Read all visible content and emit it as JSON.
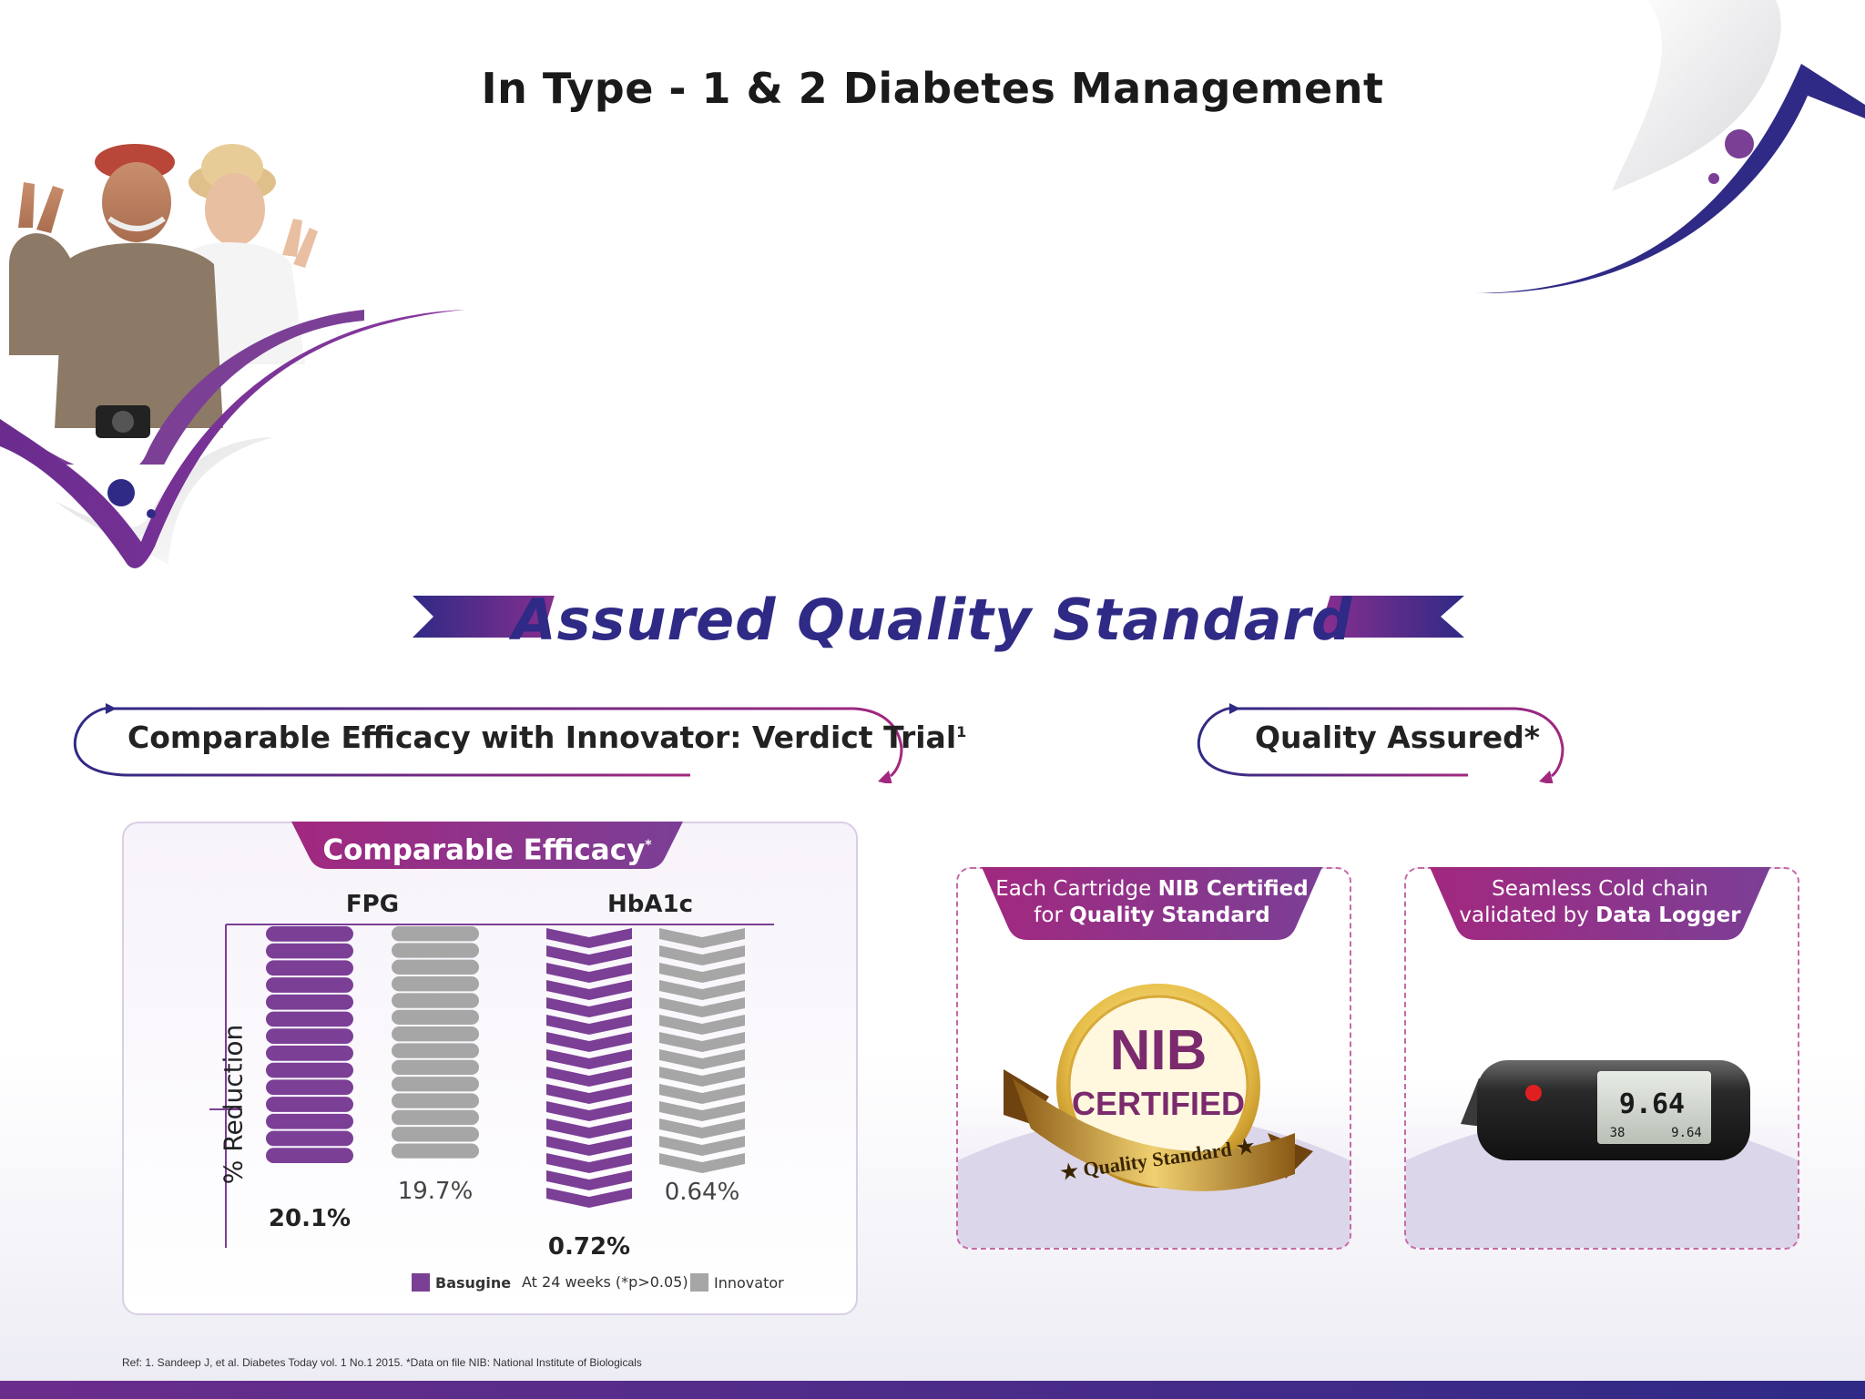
{
  "header": {
    "title": "In Type - 1 & 2 Diabetes Management"
  },
  "banner": {
    "text": "Assured Quality Standard"
  },
  "sections": {
    "efficacy_heading": "Comparable Efficacy with Innovator: Verdict Trial",
    "efficacy_heading_sup": "1",
    "quality_heading": "Quality Assured*"
  },
  "chart_panel": {
    "tab_label": "Comparable Efficacy",
    "tab_label_sup": "*",
    "y_axis_label": "% Reduction",
    "legend": {
      "basugine": "Basugine",
      "note": "At 24 weeks (*p>0.05)",
      "innovator": "Innovator"
    }
  },
  "chart_data": {
    "type": "bar",
    "categories": [
      "FPG",
      "HbA1c"
    ],
    "ylabel": "% Reduction",
    "series": [
      {
        "name": "Basugine",
        "values": [
          20.1,
          0.72
        ],
        "labels": [
          "20.1%",
          "0.72%"
        ]
      },
      {
        "name": "Innovator",
        "values": [
          19.7,
          0.64
        ],
        "labels": [
          "19.7%",
          "0.64%"
        ]
      }
    ],
    "note": "At 24 weeks (*p>0.05)"
  },
  "cards": [
    {
      "tab_line1_plain": "Each Cartridge ",
      "tab_line1_bold": "NIB Certified",
      "tab_line2_plain": "for ",
      "tab_line2_bold": "Quality Standard",
      "seal_top": "NIB",
      "seal_mid": "CERTIFIED",
      "seal_ribbon": "Quality Standard"
    },
    {
      "tab_line1_plain": "Seamless Cold chain",
      "tab_line2_plain": "validated by ",
      "tab_line2_bold": "Data Logger",
      "logger_main": "9.64",
      "logger_small_left": "38",
      "logger_small_right": "9.64"
    }
  ],
  "footer": {
    "reference": "Ref: 1. Sandeep J, et al. Diabetes Today vol. 1 No.1 2015.    *Data on file    NIB: National Institute of Biologicals"
  },
  "colors": {
    "purple": "#7b3f96",
    "navy": "#2f2a85",
    "magenta": "#a2287f",
    "grey": "#a6a6a6"
  }
}
